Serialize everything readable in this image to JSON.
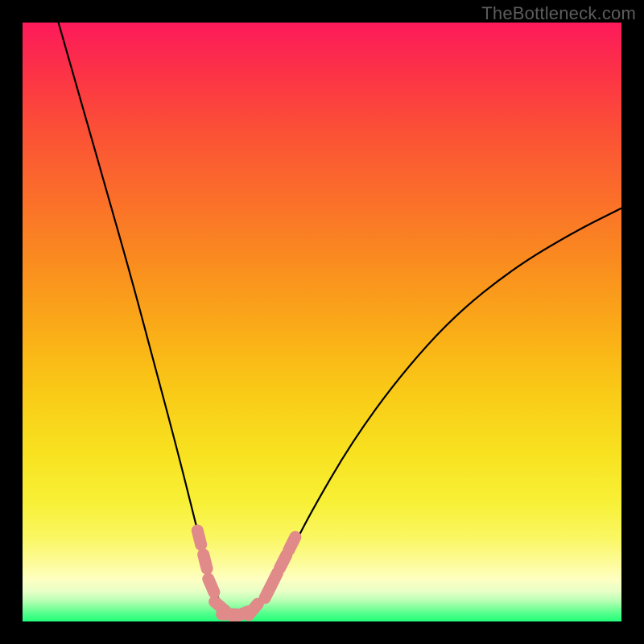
{
  "watermark": "TheBottleneck.com",
  "chart_data": {
    "type": "line",
    "title": "",
    "xlabel": "",
    "ylabel": "",
    "xlim": [
      0,
      100
    ],
    "ylim": [
      0,
      100
    ],
    "grid": false,
    "background": "rainbow-vertical-gradient",
    "curve": {
      "description": "V-shaped bottleneck curve; near-zero minimum around x≈35, steep left arm, shallower right arm",
      "points": [
        {
          "x": 6,
          "y": 100
        },
        {
          "x": 10,
          "y": 86
        },
        {
          "x": 14,
          "y": 72
        },
        {
          "x": 18,
          "y": 58
        },
        {
          "x": 22,
          "y": 43
        },
        {
          "x": 26,
          "y": 28
        },
        {
          "x": 29,
          "y": 16
        },
        {
          "x": 31,
          "y": 8
        },
        {
          "x": 33,
          "y": 3
        },
        {
          "x": 35,
          "y": 1
        },
        {
          "x": 37,
          "y": 1
        },
        {
          "x": 39,
          "y": 2
        },
        {
          "x": 41,
          "y": 5
        },
        {
          "x": 44,
          "y": 10
        },
        {
          "x": 48,
          "y": 18
        },
        {
          "x": 55,
          "y": 30
        },
        {
          "x": 63,
          "y": 41
        },
        {
          "x": 72,
          "y": 51
        },
        {
          "x": 82,
          "y": 59
        },
        {
          "x": 92,
          "y": 65
        },
        {
          "x": 100,
          "y": 69
        }
      ]
    },
    "markers": {
      "color": "#e08a8a",
      "points": [
        {
          "x": 29.5,
          "y": 14
        },
        {
          "x": 30.5,
          "y": 10
        },
        {
          "x": 31.5,
          "y": 6
        },
        {
          "x": 33,
          "y": 2.5
        },
        {
          "x": 34.5,
          "y": 1.2
        },
        {
          "x": 36.5,
          "y": 1.2
        },
        {
          "x": 38.5,
          "y": 2
        },
        {
          "x": 41,
          "y": 5
        },
        {
          "x": 42,
          "y": 7
        },
        {
          "x": 43.5,
          "y": 10
        },
        {
          "x": 45,
          "y": 13
        }
      ]
    }
  }
}
